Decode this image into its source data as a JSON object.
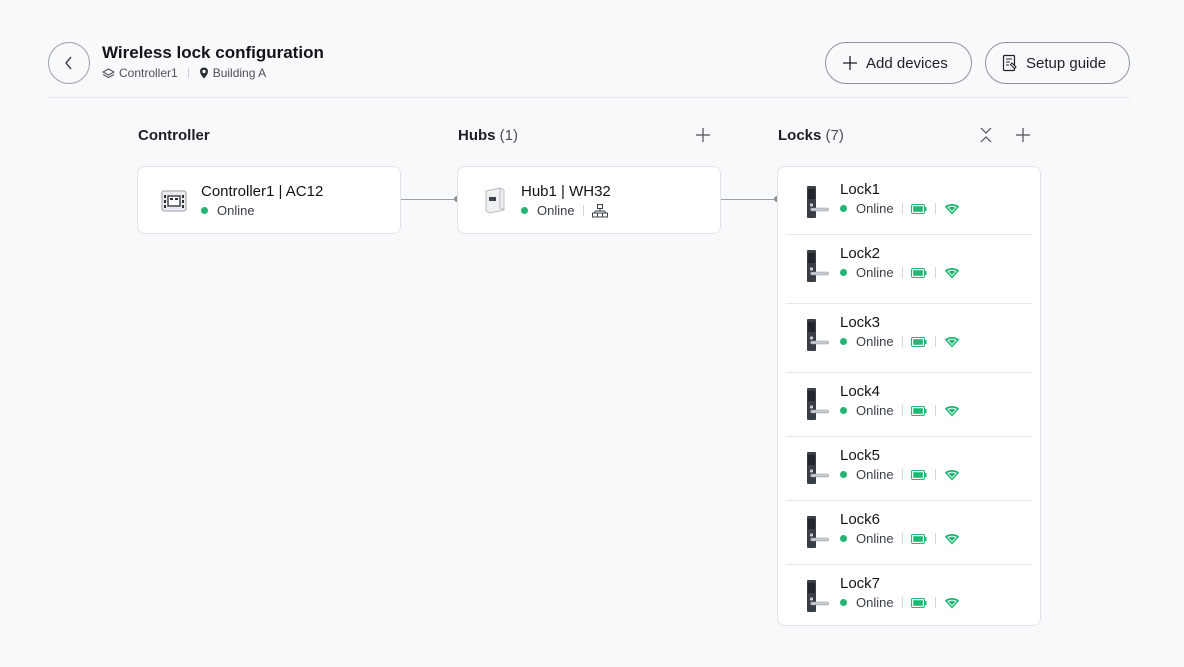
{
  "header": {
    "title": "Wireless lock configuration",
    "controller_crumb": "Controller1",
    "location_crumb": "Building A",
    "add_devices_label": "Add devices",
    "setup_guide_label": "Setup guide"
  },
  "columns": {
    "controller": {
      "title": "Controller"
    },
    "hubs": {
      "title": "Hubs",
      "count": "(1)"
    },
    "locks": {
      "title": "Locks",
      "count": "(7)"
    }
  },
  "controller": {
    "name": "Controller1 | AC12",
    "status": "Online"
  },
  "hub": {
    "name": "Hub1 | WH32",
    "status": "Online"
  },
  "locks": [
    {
      "name": "Lock1",
      "status": "Online"
    },
    {
      "name": "Lock2",
      "status": "Online"
    },
    {
      "name": "Lock3",
      "status": "Online"
    },
    {
      "name": "Lock4",
      "status": "Online"
    },
    {
      "name": "Lock5",
      "status": "Online"
    },
    {
      "name": "Lock6",
      "status": "Online"
    },
    {
      "name": "Lock7",
      "status": "Online"
    }
  ],
  "colors": {
    "online": "#22b573",
    "battery": "#22b573",
    "signal": "#22b573"
  }
}
